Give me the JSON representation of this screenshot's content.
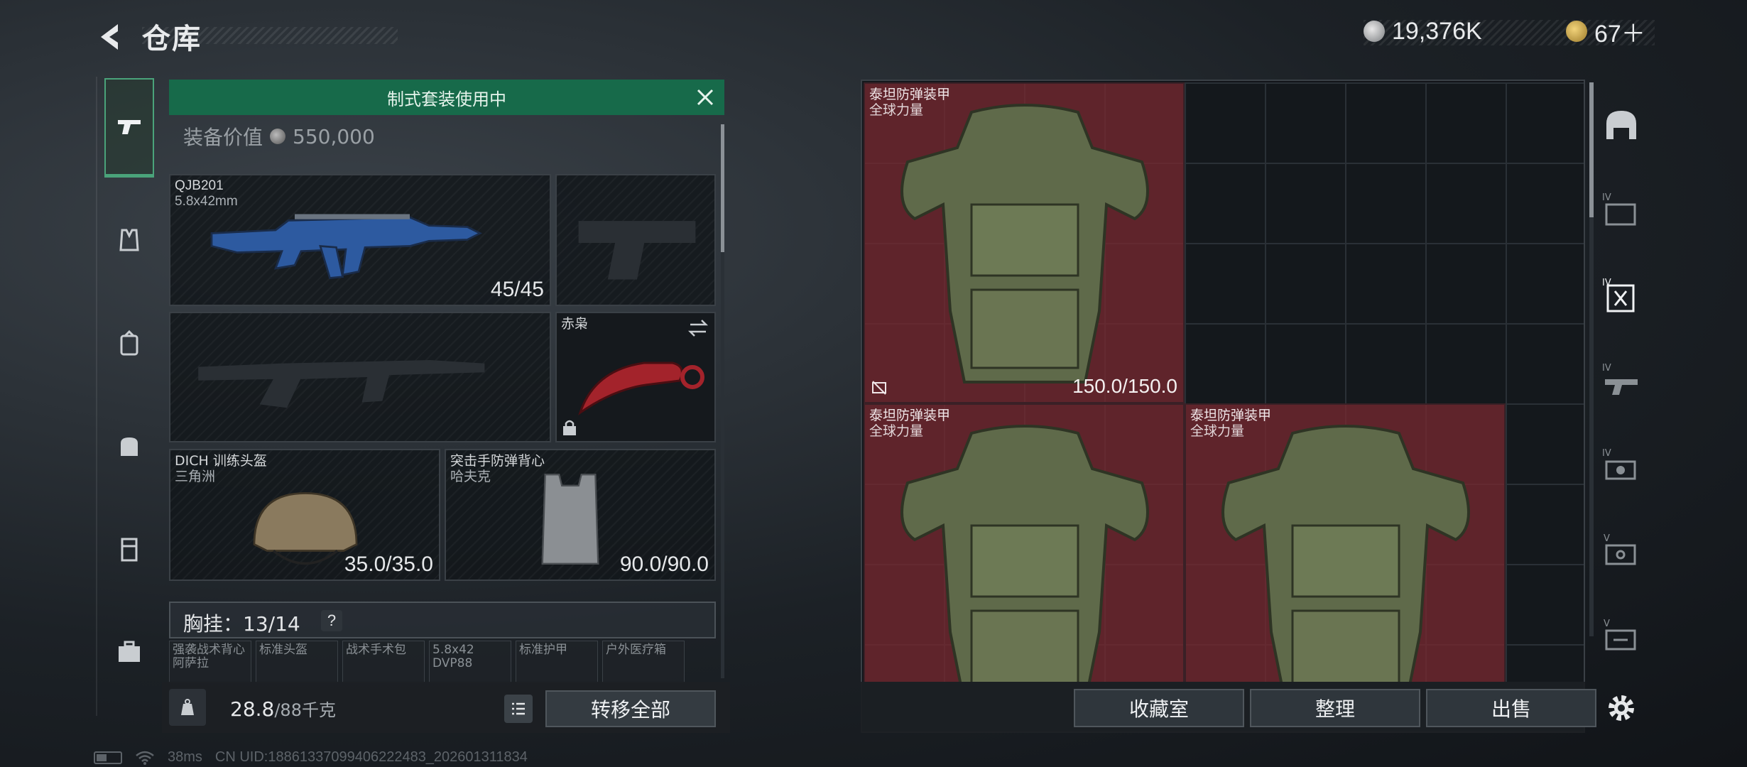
{
  "header": {
    "title": "仓库",
    "currency_silver": "19,376K",
    "currency_gold": "67＋"
  },
  "loadout": {
    "banner": "制式套装使用中",
    "value_label": "装备价值",
    "value_amount": "550,000",
    "primary_weapon": {
      "name": "QJB201",
      "caliber": "5.8x42mm",
      "ammo": "45/45"
    },
    "melee": {
      "name": "赤枭"
    },
    "helmet": {
      "name": "DICH 训练头盔",
      "faction": "三角洲",
      "durability": "35.0/35.0"
    },
    "armor": {
      "name": "突击手防弹背心",
      "faction": "哈夫克",
      "durability": "90.0/90.0"
    },
    "chest_rig": {
      "label": "胸挂：13/14",
      "help": "?"
    },
    "mini_slots": [
      {
        "l1": "强袭战术背心",
        "l2": "阿萨拉"
      },
      {
        "l1": "标准头盔",
        "l2": ""
      },
      {
        "l1": "战术手术包",
        "l2": ""
      },
      {
        "l1": "5.8x42",
        "l2": "DVP88"
      },
      {
        "l1": "标准护甲",
        "l2": ""
      },
      {
        "l1": "户外医疗箱",
        "l2": ""
      }
    ],
    "weight_value": "28.8",
    "weight_cap": "/88千克",
    "transfer_all": "转移全部"
  },
  "storage": {
    "items": [
      {
        "name": "泰坦防弹装甲",
        "sub": "全球力量",
        "durability": "150.0/150.0"
      },
      {
        "name": "泰坦防弹装甲",
        "sub": "全球力量",
        "durability": ""
      },
      {
        "name": "泰坦防弹装甲",
        "sub": "全球力量",
        "durability": ""
      }
    ],
    "actions": [
      "收藏室",
      "整理",
      "出售"
    ]
  },
  "status": {
    "ping": "38ms",
    "uid": "CN UID:188613370994062224​83_202601311834"
  },
  "colors": {
    "banner_green": "#176a4a",
    "item_red": "#78283080",
    "accent_green": "#4aa37a"
  },
  "icons": {
    "back": "chevron-left-icon",
    "left_nav": [
      "pistol-icon",
      "vest-icon",
      "backpack-icon",
      "bag-icon",
      "locker-icon",
      "briefcase-icon"
    ],
    "right_rail": [
      "helmet-icon",
      "folder-iv-icon",
      "armor-iv-icon",
      "weapon-iv-icon",
      "gear-iv-icon",
      "case-v-icon",
      "case-v2-icon",
      "settings-icon"
    ]
  }
}
